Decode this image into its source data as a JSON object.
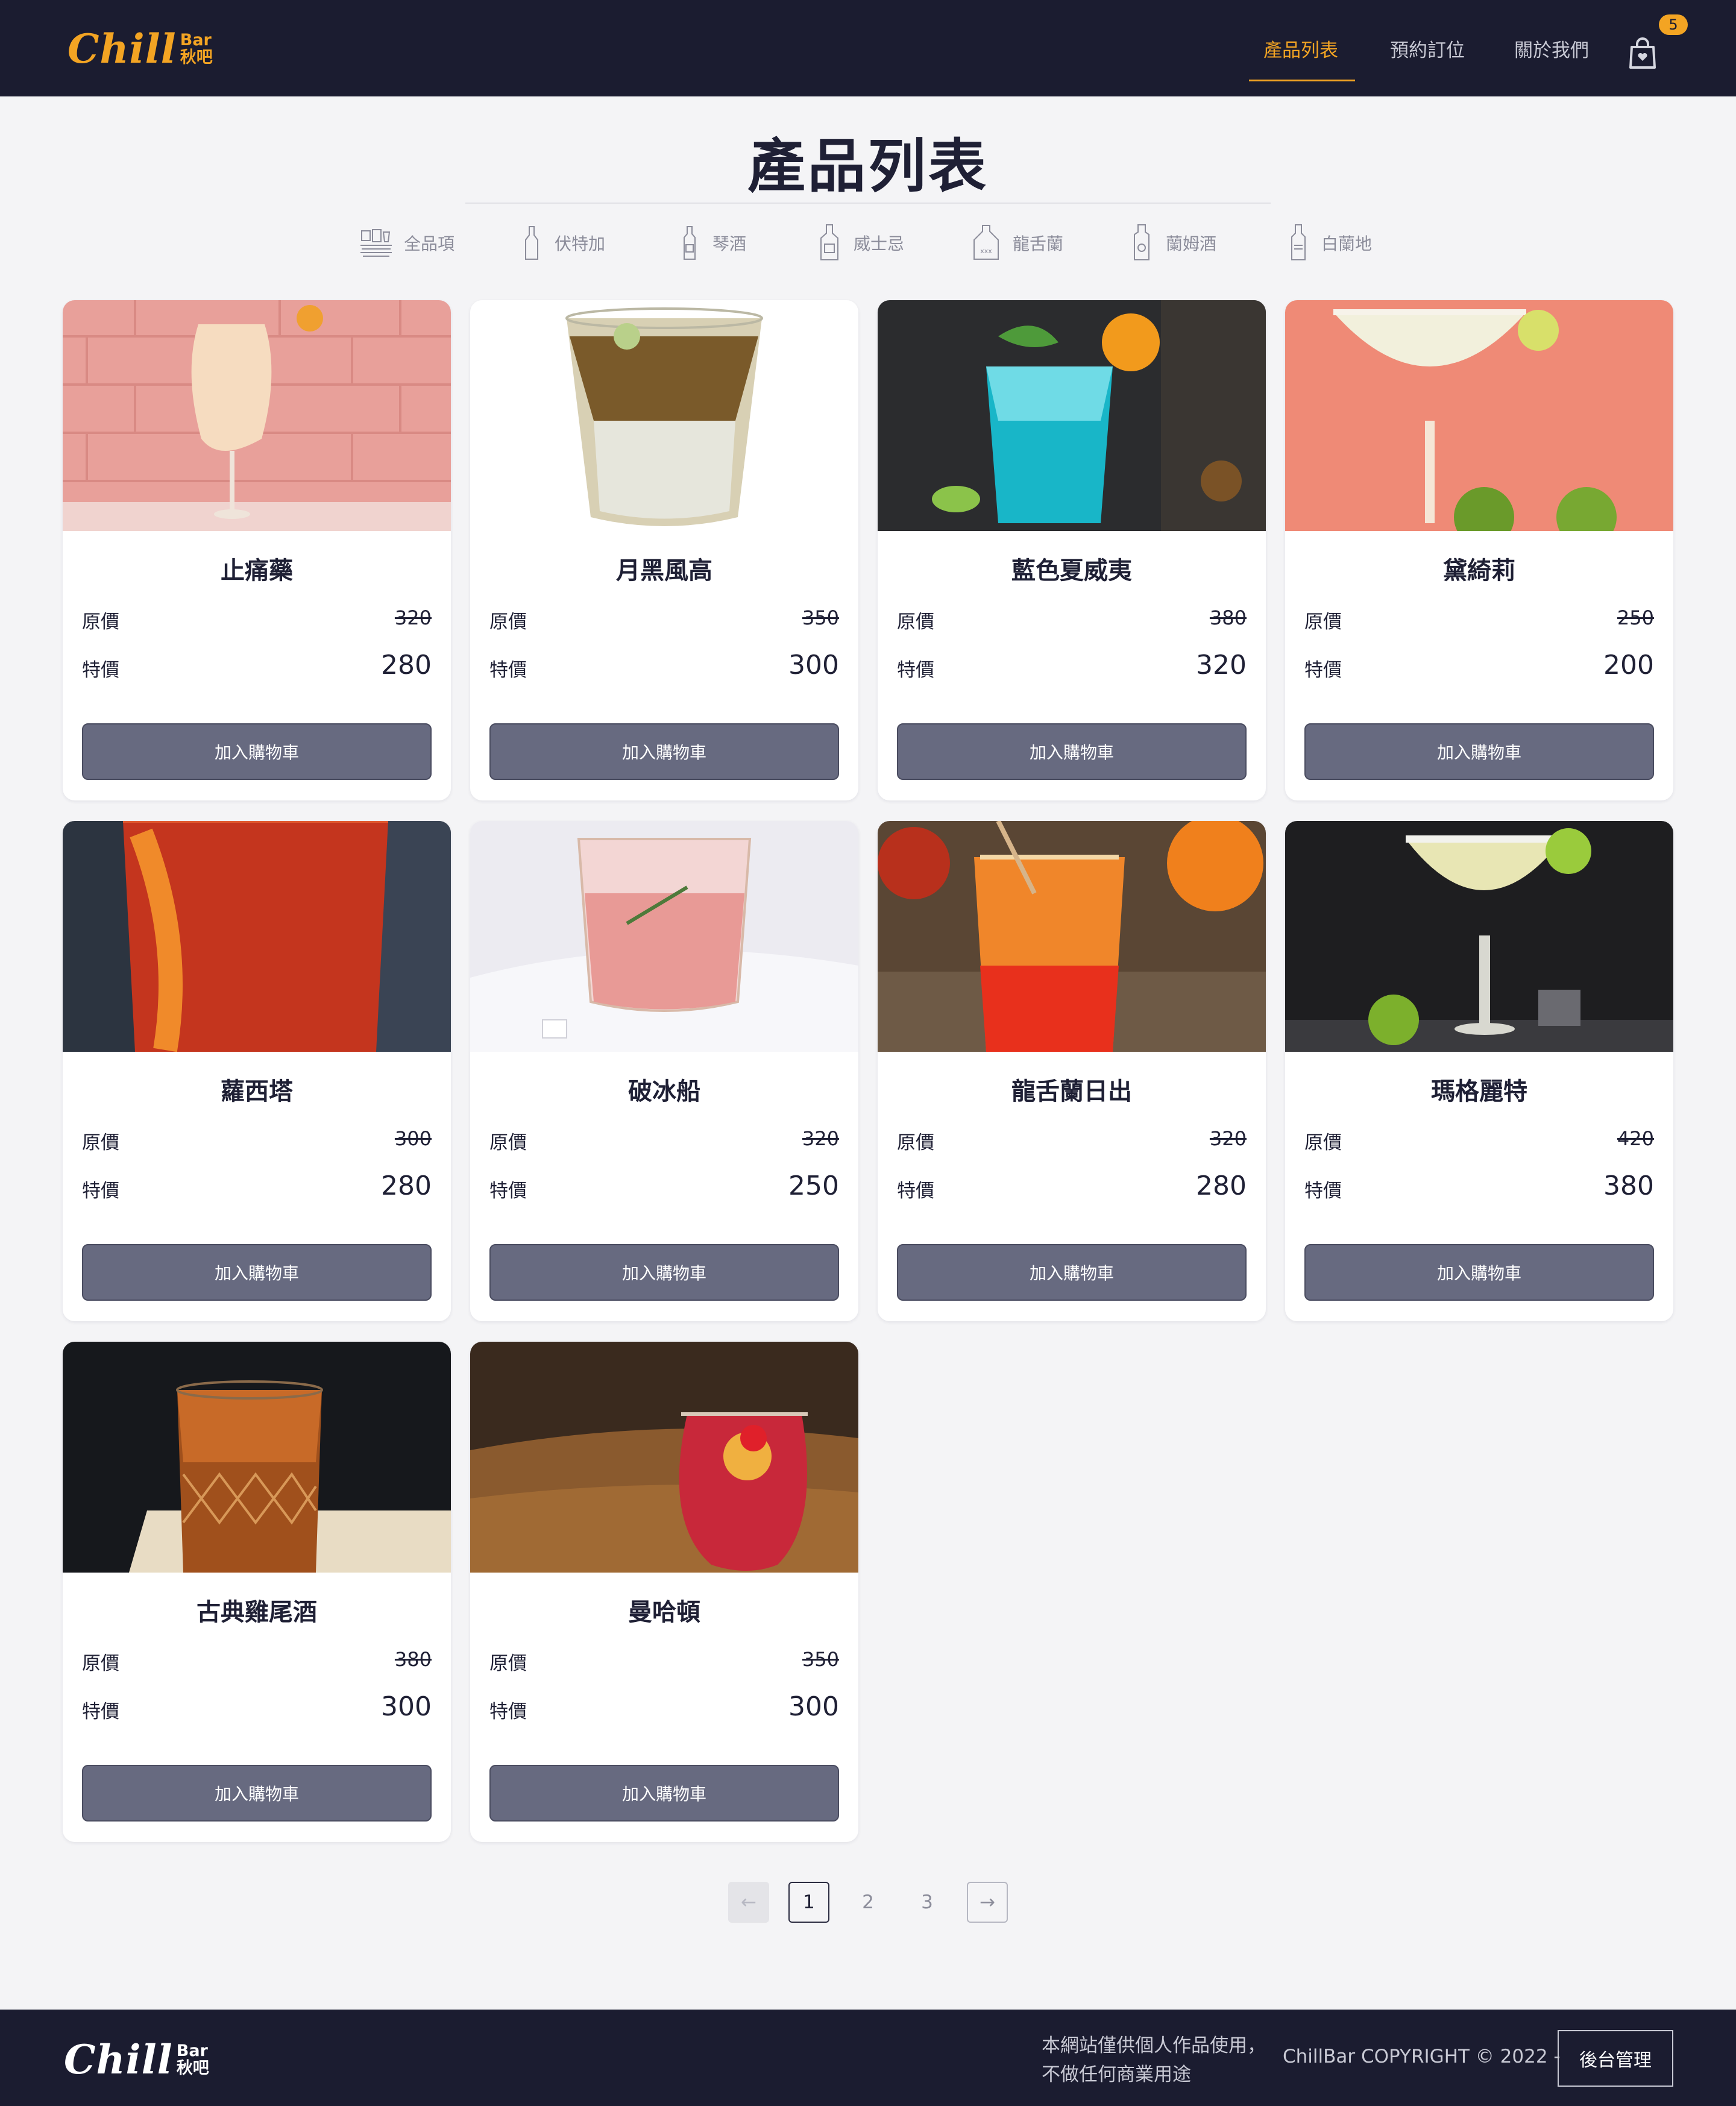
{
  "brand": {
    "name": "Chill",
    "sub_en": "Bar",
    "sub_zh": "秋吧"
  },
  "nav": {
    "items": [
      {
        "label": "產品列表",
        "active": true
      },
      {
        "label": "預約訂位",
        "active": false
      },
      {
        "label": "關於我們",
        "active": false
      }
    ],
    "cart_count": "5"
  },
  "page": {
    "title": "產品列表"
  },
  "categories": [
    {
      "label": "全品項",
      "icon": "glasses-icon"
    },
    {
      "label": "伏特加",
      "icon": "vodka-bottle-icon"
    },
    {
      "label": "琴酒",
      "icon": "gin-bottle-icon"
    },
    {
      "label": "威士忌",
      "icon": "whisky-bottle-icon"
    },
    {
      "label": "龍舌蘭",
      "icon": "tequila-bottle-icon"
    },
    {
      "label": "蘭姆酒",
      "icon": "rum-bottle-icon"
    },
    {
      "label": "白蘭地",
      "icon": "brandy-bottle-icon"
    }
  ],
  "labels": {
    "original": "原價",
    "sale": "特價",
    "add_to_cart": "加入購物車"
  },
  "products": [
    {
      "name": "止痛藥",
      "original": "320",
      "sale": "280"
    },
    {
      "name": "月黑風高",
      "original": "350",
      "sale": "300"
    },
    {
      "name": "藍色夏威夷",
      "original": "380",
      "sale": "320"
    },
    {
      "name": "黛綺莉",
      "original": "250",
      "sale": "200"
    },
    {
      "name": "蘿西塔",
      "original": "300",
      "sale": "280"
    },
    {
      "name": "破冰船",
      "original": "320",
      "sale": "250"
    },
    {
      "name": "龍舌蘭日出",
      "original": "320",
      "sale": "280"
    },
    {
      "name": "瑪格麗特",
      "original": "420",
      "sale": "380"
    },
    {
      "name": "古典雞尾酒",
      "original": "380",
      "sale": "300"
    },
    {
      "name": "曼哈頓",
      "original": "350",
      "sale": "300"
    }
  ],
  "pagination": {
    "prev": "←",
    "pages": [
      "1",
      "2",
      "3"
    ],
    "current": "1",
    "next": "→"
  },
  "footer": {
    "note_line1": "本網站僅供個人作品使用，",
    "note_line2": "不做任何商業用途",
    "copyright": "ChillBar COPYRIGHT © 2022  -",
    "admin_label": "後台管理"
  },
  "colors": {
    "navy": "#1b1c30",
    "accent": "#f3a423",
    "button": "#676a80",
    "background": "#f4f4f6"
  }
}
